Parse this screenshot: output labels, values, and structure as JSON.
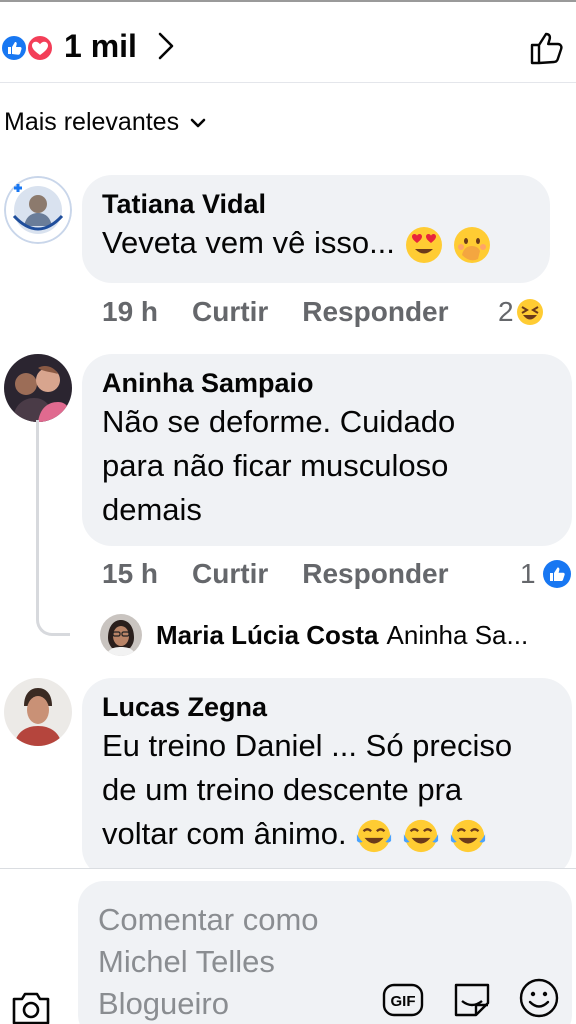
{
  "reactions": {
    "count": "1 mil",
    "icons": [
      "like-icon",
      "love-icon"
    ]
  },
  "sort": {
    "label": "Mais relevantes",
    "icon": "chevron-down-icon"
  },
  "comments": [
    {
      "author": "Tatiana Vidal",
      "text": "Veveta vem vê isso...",
      "emojis": [
        "heart-eyes-emoji",
        "hand-over-mouth-emoji"
      ],
      "time": "19 h",
      "like_label": "Curtir",
      "reply_label": "Responder",
      "reaction_count": "2",
      "reaction_icon": "laughing-emoji"
    },
    {
      "author": "Aninha Sampaio",
      "lines": [
        "Não se deforme. Cuidado",
        "para não ficar musculoso",
        "demais"
      ],
      "time": "15 h",
      "like_label": "Curtir",
      "reply_label": "Responder",
      "reaction_count": "1",
      "reaction_icon": "like-icon"
    },
    {
      "author": "Lucas Zegna",
      "lines": [
        "Eu treino Daniel ... Só preciso",
        "de um treino descente pra",
        "voltar com ânimo."
      ],
      "emojis": [
        "tears-of-joy-emoji",
        "tears-of-joy-emoji",
        "tears-of-joy-emoji"
      ]
    }
  ],
  "reply_preview": {
    "author": "Maria Lúcia Costa",
    "text": "Aninha Sa..."
  },
  "composer": {
    "placeholder_lines": [
      "Comentar como",
      "Michel Telles",
      "Blogueiro"
    ],
    "gif_label": "GIF"
  },
  "colors": {
    "bubble": "#f0f2f5",
    "like_blue": "#1877f2",
    "love_red": "#f33e58",
    "muted": "#65676b"
  }
}
